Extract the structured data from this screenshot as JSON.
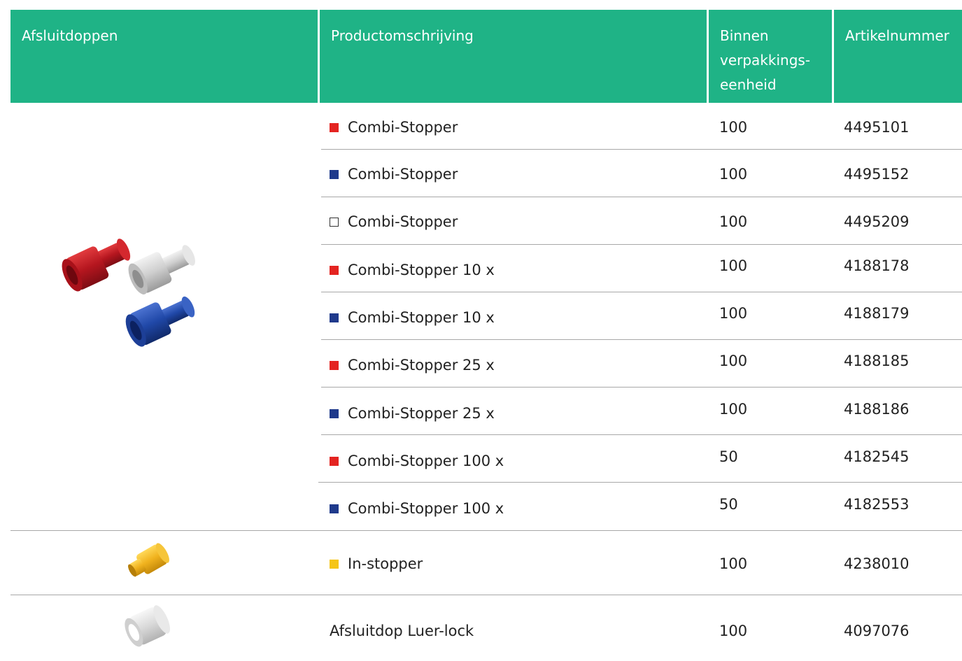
{
  "header": {
    "col1": "Afsluitdoppen",
    "col2": "Productomschrijving",
    "col3_line1": "Binnen",
    "col3_line2": "verpakkings-",
    "col3_line3": "eenheid",
    "col4": "Artikelnummer"
  },
  "colors": {
    "header_bg": "#1fb386",
    "red": "#e42421",
    "blue": "#1f3a8c",
    "yellow": "#f5c518"
  },
  "rows": [
    {
      "swatch": "red",
      "desc": "Combi-Stopper",
      "qty": "100",
      "art": "4495101"
    },
    {
      "swatch": "blue",
      "desc": "Combi-Stopper",
      "qty": "100",
      "art": "4495152"
    },
    {
      "swatch": "white",
      "desc": "Combi-Stopper",
      "qty": "100",
      "art": "4495209"
    },
    {
      "swatch": "red",
      "desc": "Combi-Stopper 10 x",
      "qty": "100",
      "art": "4188178"
    },
    {
      "swatch": "blue",
      "desc": "Combi-Stopper 10 x",
      "qty": "100",
      "art": "4188179"
    },
    {
      "swatch": "red",
      "desc": "Combi-Stopper 25 x",
      "qty": "100",
      "art": "4188185"
    },
    {
      "swatch": "blue",
      "desc": "Combi-Stopper 25 x",
      "qty": "100",
      "art": "4188186"
    },
    {
      "swatch": "red",
      "desc": "Combi-Stopper 100 x",
      "qty": "50",
      "art": "4182545"
    },
    {
      "swatch": "blue",
      "desc": "Combi-Stopper 100 x",
      "qty": "50",
      "art": "4182553"
    },
    {
      "swatch": "yellow",
      "desc": "In-stopper",
      "qty": "100",
      "art": "4238010"
    },
    {
      "swatch": "none",
      "desc": "Afsluitdop Luer-lock",
      "qty": "100",
      "art": "4097076"
    }
  ]
}
